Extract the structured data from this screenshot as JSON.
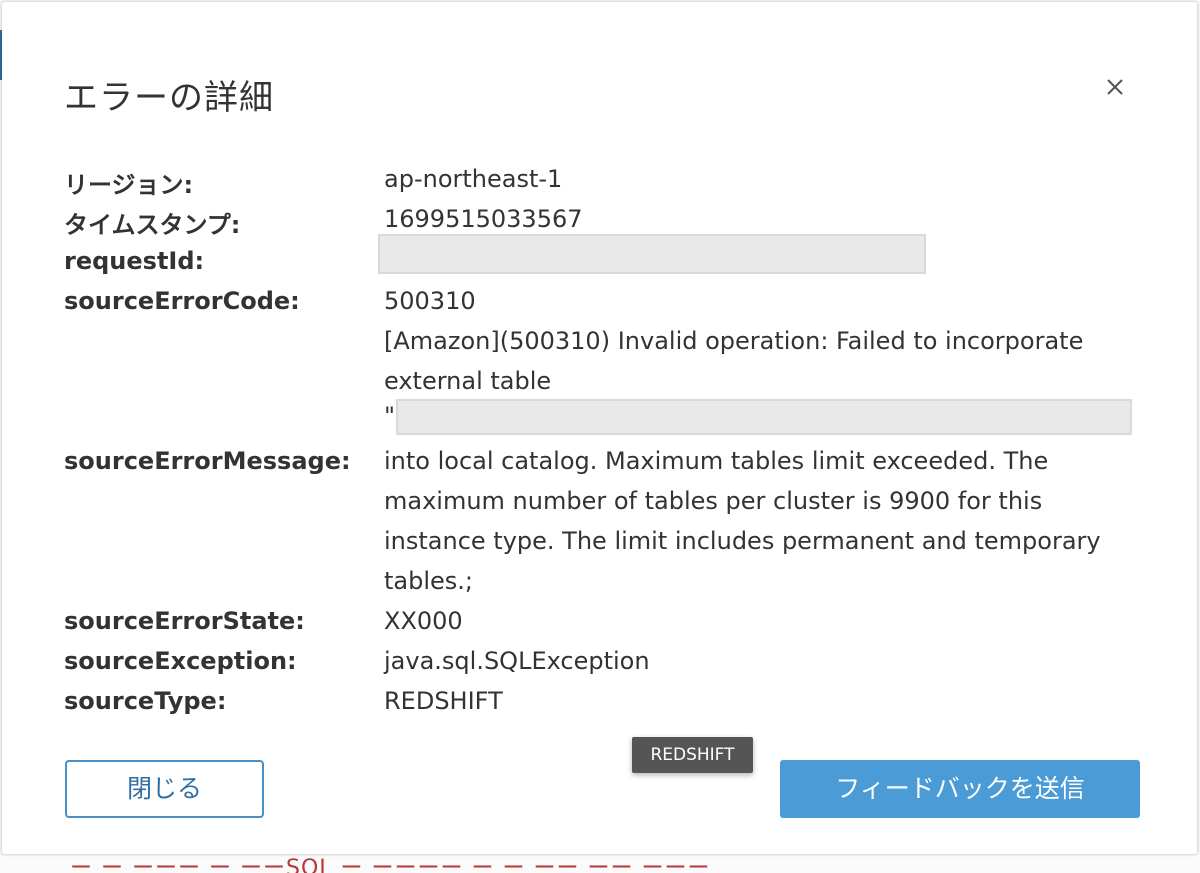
{
  "modal": {
    "title": "エラーの詳細",
    "close_icon": "close-icon"
  },
  "details": {
    "region_label": "リージョン:",
    "region_value": "ap-northeast-1",
    "timestamp_label": "タイムスタンプ:",
    "timestamp_value": "1699515033567",
    "request_id_label": "requestId:",
    "source_error_code_label": "sourceErrorCode:",
    "source_error_code_value": "500310",
    "source_error_message_label": "sourceErrorMessage:",
    "source_error_message_lines": [
      "[Amazon](500310) Invalid operation: Failed to incorporate",
      "external table",
      "\"",
      "into local catalog. Maximum tables limit exceeded. The",
      "maximum number of tables per cluster is 9900 for this",
      "instance type. The limit includes permanent and temporary",
      "tables.;"
    ],
    "source_error_state_label": "sourceErrorState:",
    "source_error_state_value": "XX000",
    "source_exception_label": "sourceException:",
    "source_exception_value": "java.sql.SQLException",
    "source_type_label": "sourceType:",
    "source_type_value": "REDSHIFT"
  },
  "tooltip": {
    "text": "REDSHIFT"
  },
  "footer": {
    "close_label": "閉じる",
    "feedback_label": "フィードバックを送信"
  },
  "background": {
    "partial_text": "ー ー ーーー ー ーーSQL ー ーーーー ー ー ーー ーー ーーー"
  },
  "colors": {
    "primary_button": "#4a9bd6",
    "secondary_border": "#4a90c4",
    "text": "#333333",
    "tooltip_bg": "#555555"
  }
}
